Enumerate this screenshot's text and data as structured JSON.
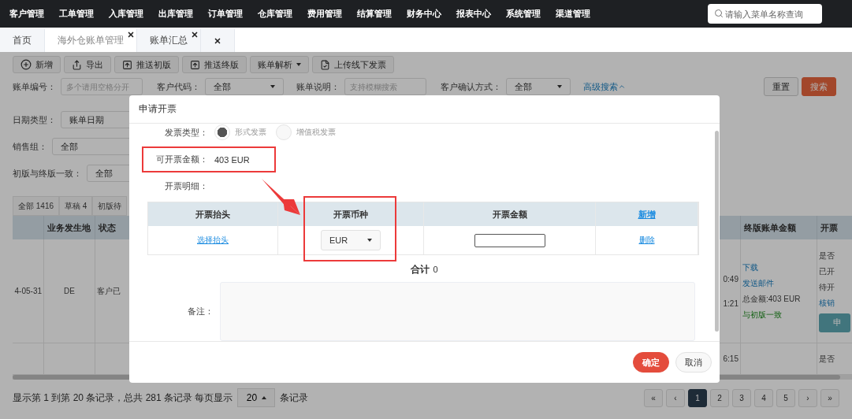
{
  "top_nav": {
    "items": [
      "客户管理",
      "工单管理",
      "入库管理",
      "出库管理",
      "订单管理",
      "仓库管理",
      "费用管理",
      "结算管理",
      "财务中心",
      "报表中心",
      "系统管理",
      "渠道管理"
    ],
    "search": {
      "placeholder": "请输入菜单名称查询"
    }
  },
  "tabs": [
    {
      "label": "首页",
      "selected": false,
      "closable": false
    },
    {
      "label": "海外仓账单管理",
      "selected": true,
      "closable": true
    },
    {
      "label": "账单汇总",
      "selected": false,
      "closable": true
    }
  ],
  "close_all_tab": true,
  "toolbar": [
    {
      "label": "新增",
      "kind": "add"
    },
    {
      "label": "导出",
      "kind": "export"
    },
    {
      "label": "推送初版",
      "kind": "upload"
    },
    {
      "label": "推送终版",
      "kind": "upload"
    },
    {
      "label": "账单解析",
      "kind": "dropdown"
    },
    {
      "label": "上传线下发票",
      "kind": "invoice"
    }
  ],
  "filters": [
    {
      "label": "账单编号：",
      "kind": "input",
      "placeholder": "多个请用空格分开"
    },
    {
      "label": "客户代码：",
      "kind": "select",
      "value": "全部"
    },
    {
      "label": "账单说明：",
      "kind": "input",
      "placeholder": "支持模糊搜索"
    },
    {
      "label": "客户确认方式：",
      "kind": "select",
      "value": "全部"
    }
  ],
  "advanced_search": "高级搜索",
  "filter_buttons": [
    {
      "label": "重置",
      "kind": "default"
    },
    {
      "label": "搜索",
      "kind": "primary"
    }
  ],
  "side_filters": [
    {
      "label": "日期类型：",
      "value": "账单日期"
    },
    {
      "label": "销售组：",
      "value": "全部"
    },
    {
      "label": "初版与终版一致：",
      "value": "全部"
    }
  ],
  "status_tabs": [
    "全部 1416",
    "草稿 4",
    "初版待"
  ],
  "table": {
    "columns": [
      "业务发生地",
      "状态",
      "终版账单金额",
      "开票"
    ],
    "rows": [
      {
        "date": "4-05-31",
        "location": "DE",
        "status": "客户已",
        "times": [
          "0:49",
          "1:21"
        ],
        "amount_lines": [
          {
            "text": "下载",
            "kind": "link"
          },
          {
            "text": "发送邮件",
            "kind": "link"
          },
          {
            "text": "总金额:403 EUR",
            "kind": "text"
          },
          {
            "text": "与初版一致",
            "kind": "ok"
          }
        ],
        "invoice_lines": [
          {
            "text": "是否",
            "kind": "text"
          },
          {
            "text": "已开",
            "kind": "text"
          },
          {
            "text": "待开",
            "kind": "text"
          },
          {
            "text": "核销",
            "kind": "link"
          },
          {
            "text": "申",
            "kind": "button"
          }
        ]
      },
      {
        "times": [
          "6:15"
        ],
        "amount_lines": [],
        "invoice_lines": [
          {
            "text": "是否",
            "kind": "text"
          }
        ]
      }
    ]
  },
  "footer": {
    "summary": "显示第 1 到第 20 条记录，总共 281 条记录 每页显示",
    "page_size": "20",
    "unit": "条记录",
    "pages": [
      {
        "label": "«",
        "selected": false
      },
      {
        "label": "‹",
        "selected": false
      },
      {
        "label": "1",
        "selected": true
      },
      {
        "label": "2",
        "selected": false
      },
      {
        "label": "3",
        "selected": false
      },
      {
        "label": "4",
        "selected": false
      },
      {
        "label": "5",
        "selected": false
      },
      {
        "label": "›",
        "selected": false
      },
      {
        "label": "»",
        "selected": false
      }
    ]
  },
  "modal": {
    "title": "申请开票",
    "invoice_type": {
      "label": "发票类型：",
      "options": [
        {
          "label": "形式发票",
          "selected": true
        },
        {
          "label": "增值税发票",
          "selected": false
        }
      ]
    },
    "amount": {
      "label": "可开票金额：",
      "value": "403 EUR",
      "highlighted": true
    },
    "detail_label": "开票明细：",
    "detail_table": {
      "columns": [
        "开票抬头",
        "开票币种",
        "开票金额"
      ],
      "add_link": "新增",
      "rows": [
        {
          "title_link": "选择抬头",
          "currency": "EUR",
          "delete_link": "删除"
        }
      ],
      "currency_highlighted": true
    },
    "arrow": true,
    "total": {
      "label": "合计",
      "value": "0"
    },
    "remark_label": "备注：",
    "buttons": [
      {
        "label": "确定",
        "kind": "primary"
      },
      {
        "label": "取消",
        "kind": "default"
      }
    ]
  }
}
